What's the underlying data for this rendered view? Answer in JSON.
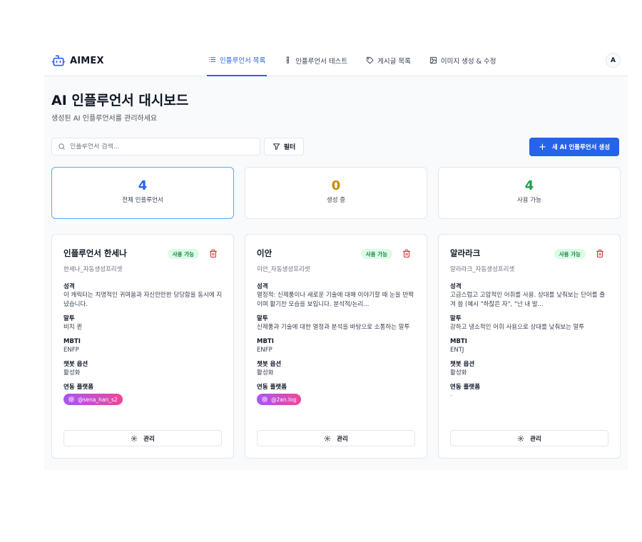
{
  "brand": {
    "name": "AIMEX",
    "icon": "robot-icon"
  },
  "nav": {
    "items": [
      {
        "label": "인플루언서 목록",
        "icon": "list-icon",
        "active": true
      },
      {
        "label": "인플루언서 테스트",
        "icon": "test-tube-icon",
        "active": false
      },
      {
        "label": "게시글 목록",
        "icon": "tag-icon",
        "active": false
      },
      {
        "label": "이미지 생성 & 수정",
        "icon": "image-icon",
        "active": false
      }
    ]
  },
  "user": {
    "avatar_initial": "A"
  },
  "page": {
    "title": "AI 인플루언서 대시보드",
    "subtitle": "생성된 AI 인플루언서를 관리하세요"
  },
  "toolbar": {
    "search_placeholder": "인플루언서 검색...",
    "filter_label": "필터",
    "create_label": "새 AI 인플루언서 생성"
  },
  "stats": [
    {
      "value": "4",
      "label": "전체 인플루언서",
      "color": "#2563eb"
    },
    {
      "value": "0",
      "label": "생성 중",
      "color": "#ca8a04"
    },
    {
      "value": "4",
      "label": "사용 가능",
      "color": "#16a34a"
    }
  ],
  "cards": [
    {
      "name": "인플루언서 한세나",
      "status": "사용 가능",
      "preset": "한세나_자동생성프리셋",
      "personality_label": "성격",
      "personality": "이 캐릭터는 치명적인 귀여움과 자신만만한 당당함을 동시에 지녔습니다.",
      "speech_label": "말투",
      "speech": "비치 퀸",
      "mbti_label": "MBTI",
      "mbti": "ENFP",
      "chatbot_label": "챗봇 옵션",
      "chatbot": "활성화",
      "platform_label": "연동 플랫폼",
      "platform": "@sena_han_s2",
      "manage_label": "관리"
    },
    {
      "name": "이안",
      "status": "사용 가능",
      "preset": "이안_자동생성프리셋",
      "personality_label": "성격",
      "personality": "열정적: 신제품이나 새로운 기술에 대해 이야기할 때 눈을 반짝이며 활기찬 모습을 보입니다. 분석적/논리...",
      "speech_label": "말투",
      "speech": "신제품과 기술에 대한 열정과 분석을 바탕으로 소통하는 말투",
      "mbti_label": "MBTI",
      "mbti": "ENFP",
      "chatbot_label": "챗봇 옵션",
      "chatbot": "활성화",
      "platform_label": "연동 플랫폼",
      "platform": "@2an.log",
      "manage_label": "관리"
    },
    {
      "name": "알라라크",
      "status": "사용 가능",
      "preset": "알라라크_자동생성프리셋",
      "personality_label": "성격",
      "personality": "고급스럽고 고압적인 어휘를 사용. 상대를 낮춰보는 단어를 즐겨 씀 (예시 \"하찮은 자\", \"넌 내 발...",
      "speech_label": "말투",
      "speech": "강하고 냉소적인 어휘 사용으로 상대를 낮춰보는 말투",
      "mbti_label": "MBTI",
      "mbti": "ENTJ",
      "chatbot_label": "챗봇 옵션",
      "chatbot": "활성화",
      "platform_label": "연동 플랫폼",
      "platform": "-",
      "manage_label": "관리"
    }
  ]
}
